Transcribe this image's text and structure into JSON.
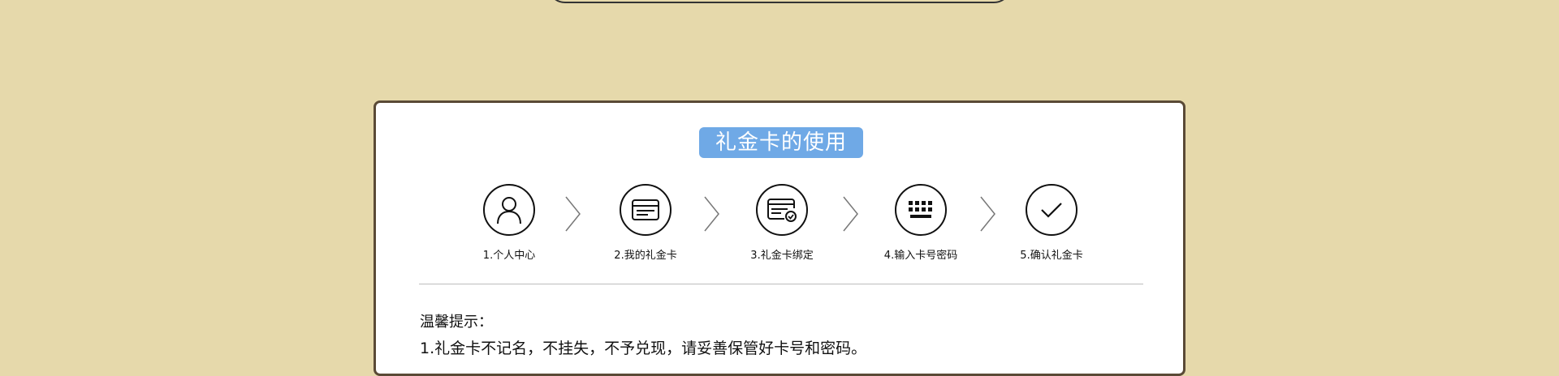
{
  "section_title": "礼金卡的使用",
  "steps": [
    {
      "label": "1.个人中心",
      "icon": "user-icon"
    },
    {
      "label": "2.我的礼金卡",
      "icon": "card-icon"
    },
    {
      "label": "3.礼金卡绑定",
      "icon": "card-bind-icon"
    },
    {
      "label": "4.输入卡号密码",
      "icon": "keyboard-icon"
    },
    {
      "label": "5.确认礼金卡",
      "icon": "check-icon"
    }
  ],
  "tips": {
    "title": "温馨提示：",
    "lines": [
      "1.礼金卡不记名，不挂失，不予兑现，请妥善保管好卡号和密码。"
    ]
  },
  "colors": {
    "page_background": "#e6d9ab",
    "title_badge": "#6fa9e6",
    "card_border": "#5a4a36"
  }
}
